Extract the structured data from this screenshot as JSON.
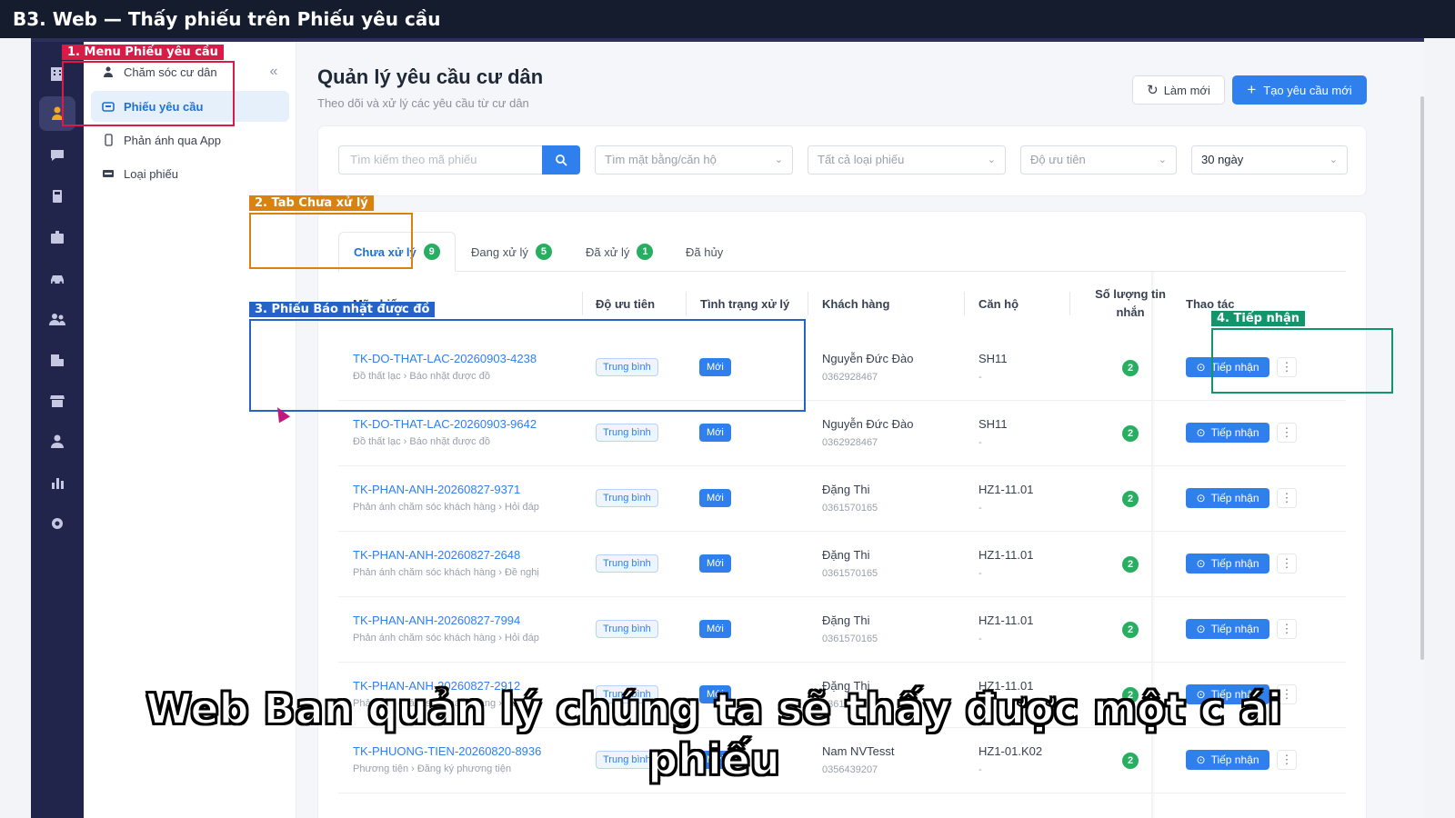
{
  "video_title": "B3. Web — Thấy phiếu trên Phiếu yêu cầu",
  "submenu": {
    "items": [
      {
        "label": "Chăm sóc cư dân",
        "icon": "care-icon"
      },
      {
        "label": "Phiếu yêu cầu",
        "icon": "ticket-icon",
        "active": true
      },
      {
        "label": "Phản ánh qua App",
        "icon": "phone-icon"
      },
      {
        "label": "Loại phiếu",
        "icon": "card-icon"
      }
    ]
  },
  "page": {
    "title": "Quản lý yêu cầu cư dân",
    "subtitle": "Theo dõi và xử lý các yêu cầu từ cư dân",
    "refresh_label": "Làm mới",
    "new_label": "Tạo yêu cầu mới"
  },
  "filters": {
    "search_placeholder": "Tìm kiếm theo mã phiếu",
    "apartment": "Tìm mặt bằng/căn hộ",
    "ticket_type": "Tất cả loại phiếu",
    "priority": "Độ ưu tiên",
    "period": "30 ngày"
  },
  "tabs": [
    {
      "label": "Chưa xử lý",
      "count": "9"
    },
    {
      "label": "Đang xử lý",
      "count": "5"
    },
    {
      "label": "Đã xử lý",
      "count": "1"
    },
    {
      "label": "Đã hủy",
      "count": ""
    }
  ],
  "table": {
    "headers": {
      "code": "Mã phiếu",
      "priority": "Độ ưu tiên",
      "status": "Tình trạng xử lý",
      "customer": "Khách hàng",
      "apartment": "Căn hộ",
      "messages": "Số lượng tin nhắn",
      "actions": "Thao tác"
    },
    "accept_label": "Tiếp nhận",
    "rows": [
      {
        "code": "TK-DO-THAT-LAC-20260903-4238",
        "category": "Đồ thất lạc › Báo nhặt được đồ",
        "priority": "Trung bình",
        "status": "Mới",
        "customer": "Nguyễn Đức Đào",
        "phone": "0362928467",
        "apartment": "SH11",
        "sub": "-",
        "messages": "2"
      },
      {
        "code": "TK-DO-THAT-LAC-20260903-9642",
        "category": "Đồ thất lạc › Báo nhặt được đồ",
        "priority": "Trung bình",
        "status": "Mới",
        "customer": "Nguyễn Đức Đào",
        "phone": "0362928467",
        "apartment": "SH11",
        "sub": "-",
        "messages": "2"
      },
      {
        "code": "TK-PHAN-ANH-20260827-9371",
        "category": "Phản ánh chăm sóc khách hàng › Hỏi đáp",
        "priority": "Trung bình",
        "status": "Mới",
        "customer": "Đặng Thi",
        "phone": "0361570165",
        "apartment": "HZ1-11.01",
        "sub": "-",
        "messages": "2"
      },
      {
        "code": "TK-PHAN-ANH-20260827-2648",
        "category": "Phản ánh chăm sóc khách hàng › Đề nghị",
        "priority": "Trung bình",
        "status": "Mới",
        "customer": "Đặng Thi",
        "phone": "0361570165",
        "apartment": "HZ1-11.01",
        "sub": "-",
        "messages": "2"
      },
      {
        "code": "TK-PHAN-ANH-20260827-7994",
        "category": "Phản ánh chăm sóc khách hàng › Hỏi đáp",
        "priority": "Trung bình",
        "status": "Mới",
        "customer": "Đặng Thi",
        "phone": "0361570165",
        "apartment": "HZ1-11.01",
        "sub": "-",
        "messages": "2"
      },
      {
        "code": "TK-PHAN-ANH-20260827-2912",
        "category": "Phản ánh chăm sóc khách hàng › Hỏi",
        "priority": "Trung bình",
        "status": "Mới",
        "customer": "Đặng Thi",
        "phone": "0361570165",
        "apartment": "HZ1-11.01",
        "sub": "-",
        "messages": "2"
      },
      {
        "code": "TK-PHUONG-TIEN-20260820-8936",
        "category": "Phương tiện › Đăng ký phương tiện",
        "priority": "Trung bình",
        "status": "Mới",
        "customer": "Nam NVTesst",
        "phone": "0356439207",
        "apartment": "HZ1-01.K02",
        "sub": "-",
        "messages": "2"
      }
    ]
  },
  "annotations": [
    {
      "label": "1. Menu Phiếu yêu cầu",
      "color": "#d81b47"
    },
    {
      "label": "2. Tab Chưa xử lý",
      "color": "#d9820d"
    },
    {
      "label": "3. Phiếu Báo nhặt được đồ",
      "color": "#2563c9"
    },
    {
      "label": "4. Tiếp nhận",
      "color": "#12956a"
    }
  ],
  "caption": "Web Ban quản lý chúng ta sẽ thấy được một c ái phiếu"
}
